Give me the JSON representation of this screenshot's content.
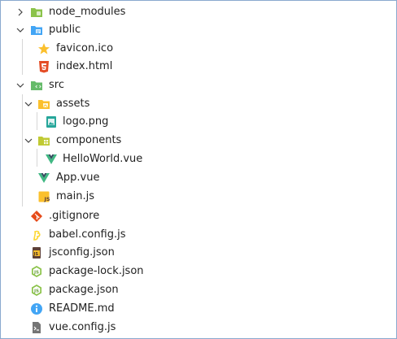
{
  "explorer": {
    "items": [
      {
        "label": "node_modules",
        "icon": "folder-node-icon",
        "color": "#8bc34a"
      },
      {
        "label": "public",
        "icon": "folder-public-icon",
        "color": "#42a5f5"
      },
      {
        "label": "favicon.ico",
        "icon": "favicon-star-icon",
        "color": "#fbc02d"
      },
      {
        "label": "index.html",
        "icon": "html5-icon",
        "color": "#e44d26"
      },
      {
        "label": "src",
        "icon": "folder-src-icon",
        "color": "#66bb6a"
      },
      {
        "label": "assets",
        "icon": "folder-assets-icon",
        "color": "#fbc02d"
      },
      {
        "label": "logo.png",
        "icon": "image-file-icon",
        "color": "#26a69a"
      },
      {
        "label": "components",
        "icon": "folder-components-icon",
        "color": "#c0ca33"
      },
      {
        "label": "HelloWorld.vue",
        "icon": "vue-icon",
        "color": "#41b883"
      },
      {
        "label": "App.vue",
        "icon": "vue-icon",
        "color": "#41b883"
      },
      {
        "label": "main.js",
        "icon": "js-file-icon",
        "color": "#fbc02d"
      },
      {
        "label": ".gitignore",
        "icon": "git-icon",
        "color": "#e64a19"
      },
      {
        "label": "babel.config.js",
        "icon": "babel-icon",
        "color": "#fdd835"
      },
      {
        "label": "jsconfig.json",
        "icon": "jsconfig-icon",
        "color": "#fbc02d"
      },
      {
        "label": "package-lock.json",
        "icon": "nodejs-icon",
        "color": "#8bc34a"
      },
      {
        "label": "package.json",
        "icon": "nodejs-icon",
        "color": "#8bc34a"
      },
      {
        "label": "README.md",
        "icon": "info-icon",
        "color": "#42a5f5"
      },
      {
        "label": "vue.config.js",
        "icon": "vue-config-icon",
        "color": "#757575"
      }
    ]
  }
}
